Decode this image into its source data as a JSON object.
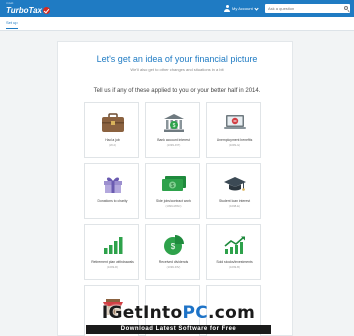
{
  "header": {
    "logo_prefix": "intuit",
    "logo_text": "TurboTax",
    "account_label": "My Account",
    "search_placeholder": "Ask a question"
  },
  "subnav": {
    "tab": "Set up"
  },
  "main": {
    "heading": "Let's get an idea of your financial picture",
    "subheading": "We'll also get to other changes and situations in a bit",
    "prompt": "Tell us if any of these applied to you or your better half in 2014."
  },
  "tiles": [
    {
      "label": "Had a job",
      "sub": "(W-2)"
    },
    {
      "label": "Bank account interest",
      "sub": "(1099-INT)"
    },
    {
      "label": "Unemployment benefits",
      "sub": "(1099-G)"
    },
    {
      "label": "Donations to charity",
      "sub": ""
    },
    {
      "label": "Side jobs/contract work",
      "sub": "(1099-MISC)"
    },
    {
      "label": "Student loan interest",
      "sub": "(1098-E)"
    },
    {
      "label": "Retirement plan withdrawals",
      "sub": "(1099-R)"
    },
    {
      "label": "Received dividends",
      "sub": "(1099-DIV)"
    },
    {
      "label": "Sold stocks/investments",
      "sub": "(1099-B)"
    },
    {
      "label": "",
      "sub": ""
    }
  ],
  "watermark": {
    "title_a": "IGetInto",
    "title_b": "PC",
    "title_c": ".com",
    "subtitle": "Download Latest Software for Free"
  },
  "colors": {
    "brand_blue": "#1f7bc3",
    "icon_green": "#2ea24b",
    "icon_brown": "#8b6240"
  }
}
